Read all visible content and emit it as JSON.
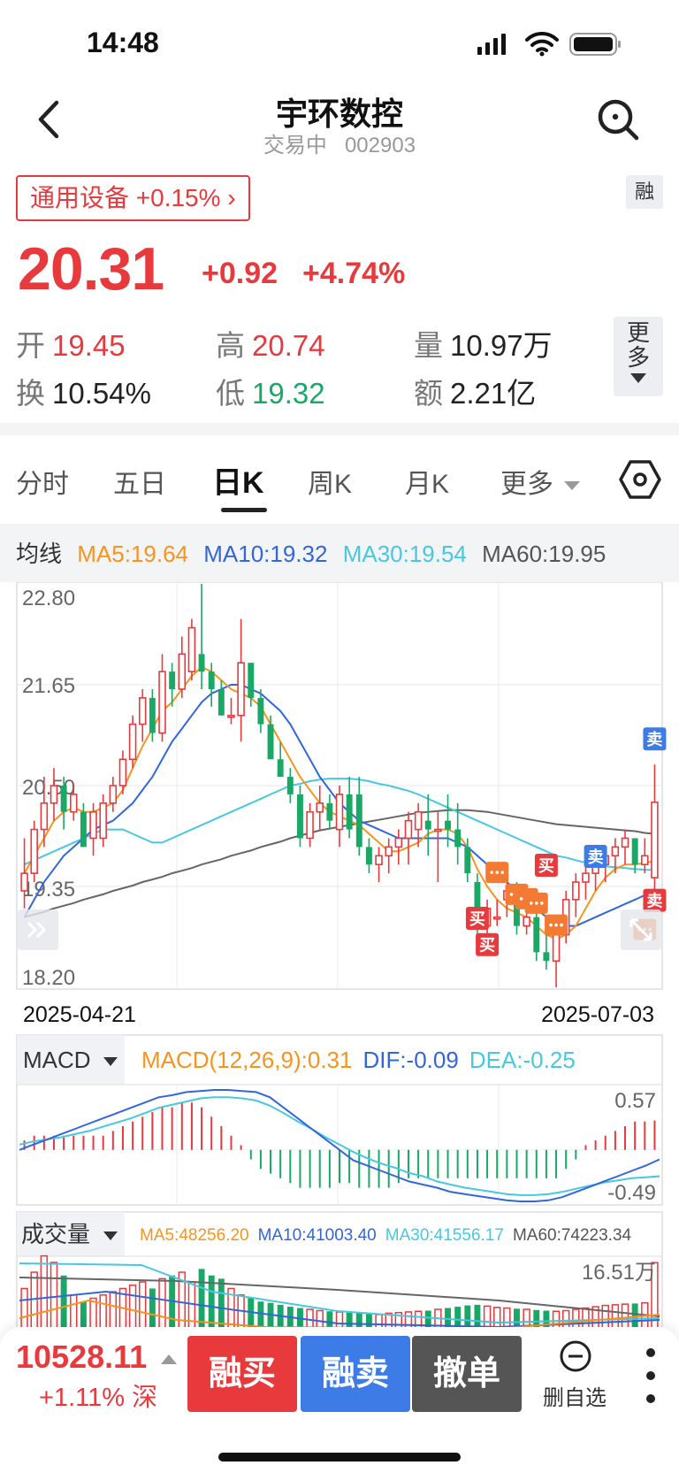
{
  "status_bar": {
    "time": "14:48"
  },
  "header": {
    "title": "宇环数控",
    "status": "交易中",
    "code": "002903"
  },
  "sector_tag": "通用设备 +0.15% ›",
  "margin_tag": "融",
  "quote": {
    "price": "20.31",
    "change": "+0.92",
    "change_pct": "+4.74%"
  },
  "stats": {
    "open": {
      "label": "开",
      "value": "19.45"
    },
    "high": {
      "label": "高",
      "value": "20.74"
    },
    "volume": {
      "label": "量",
      "value": "10.97万"
    },
    "turnover": {
      "label": "换",
      "value": "10.54%"
    },
    "low": {
      "label": "低",
      "value": "19.32"
    },
    "amount": {
      "label": "额",
      "value": "2.21亿"
    }
  },
  "more_btn": "更多",
  "tabs": [
    "分时",
    "五日",
    "日K",
    "周K",
    "月K",
    "更多"
  ],
  "active_tab": "日K",
  "ma_legend": {
    "label": "均线",
    "ma5": "MA5:19.64",
    "ma10": "MA10:19.32",
    "ma30": "MA30:19.54",
    "ma60": "MA60:19.95"
  },
  "colors": {
    "up": "#e8393d",
    "down": "#1aa866",
    "ma5": "#f7941d",
    "ma10": "#3366dd",
    "ma30": "#48c8e0",
    "ma60": "#666666",
    "sell_badge": "#3d7be6",
    "buy_badge": "#e8393d"
  },
  "price_chart": {
    "y_ticks": [
      "22.80",
      "21.65",
      "20.50",
      "19.35",
      "18.20"
    ],
    "date_start": "2025-04-21",
    "date_end": "2025-07-03",
    "markers": {
      "buy": "买",
      "sell": "卖"
    }
  },
  "macd_panel": {
    "selector": "MACD",
    "title": "MACD(12,26,9):0.31",
    "dif": "DIF:-0.09",
    "dea": "DEA:-0.25",
    "max_label": "0.57",
    "min_label": "-0.49"
  },
  "volume_panel": {
    "selector": "成交量",
    "ma5": "MA5:48256.20",
    "ma10": "MA10:41003.40",
    "ma30": "MA30:41556.17",
    "ma60": "MA60:74223.34",
    "max_label": "16.51万"
  },
  "bottom_bar": {
    "index_value": "10528.11",
    "index_change": "+1.11% 深",
    "margin_buy": "融买",
    "margin_sell": "融卖",
    "cancel": "撤单",
    "delete_watch": "删自选"
  },
  "chart_data": {
    "type": "candlestick",
    "title": "",
    "x_start": "2025-04-21",
    "x_end": "2025-07-03",
    "ylim": [
      18.2,
      22.8
    ],
    "candles": [
      [
        19.3,
        19.9,
        19.1,
        19.5
      ],
      [
        19.5,
        20.1,
        19.4,
        20.0
      ],
      [
        20.0,
        20.6,
        19.8,
        20.3
      ],
      [
        20.3,
        20.7,
        20.1,
        20.5
      ],
      [
        20.5,
        20.6,
        20.0,
        20.2
      ],
      [
        20.2,
        20.5,
        20.1,
        20.4
      ],
      [
        20.2,
        20.3,
        19.8,
        19.8
      ],
      [
        19.9,
        20.3,
        19.7,
        20.2
      ],
      [
        19.9,
        20.4,
        19.8,
        20.3
      ],
      [
        20.3,
        20.6,
        20.2,
        20.5
      ],
      [
        20.5,
        20.9,
        20.4,
        20.8
      ],
      [
        20.8,
        21.3,
        20.7,
        21.2
      ],
      [
        21.2,
        21.6,
        21.0,
        21.5
      ],
      [
        21.5,
        21.6,
        21.0,
        21.1
      ],
      [
        21.1,
        22.0,
        21.0,
        21.8
      ],
      [
        21.8,
        21.9,
        21.4,
        21.6
      ],
      [
        21.6,
        22.2,
        21.5,
        22.0
      ],
      [
        21.8,
        22.4,
        21.7,
        22.3
      ],
      [
        22.0,
        22.8,
        21.6,
        21.8
      ],
      [
        21.8,
        21.9,
        21.4,
        21.6
      ],
      [
        21.6,
        21.7,
        21.3,
        21.3
      ],
      [
        21.3,
        21.5,
        21.2,
        21.3
      ],
      [
        21.3,
        22.4,
        21.0,
        21.9
      ],
      [
        21.9,
        21.9,
        21.4,
        21.5
      ],
      [
        21.5,
        21.6,
        21.1,
        21.2
      ],
      [
        21.2,
        21.3,
        20.8,
        20.8
      ],
      [
        20.8,
        21.0,
        20.6,
        20.6
      ],
      [
        20.6,
        20.7,
        20.3,
        20.4
      ],
      [
        20.4,
        20.5,
        19.8,
        19.9
      ],
      [
        19.9,
        20.3,
        19.8,
        20.2
      ],
      [
        20.2,
        20.5,
        20.0,
        20.3
      ],
      [
        20.3,
        20.4,
        20.0,
        20.1
      ],
      [
        20.0,
        20.5,
        19.8,
        20.4
      ],
      [
        20.4,
        20.6,
        19.9,
        20.0
      ],
      [
        20.4,
        20.6,
        19.7,
        19.8
      ],
      [
        19.8,
        19.9,
        19.5,
        19.6
      ],
      [
        19.6,
        19.8,
        19.4,
        19.7
      ],
      [
        19.7,
        19.9,
        19.5,
        19.8
      ],
      [
        19.8,
        20.0,
        19.6,
        19.9
      ],
      [
        19.9,
        20.2,
        19.6,
        20.1
      ],
      [
        20.0,
        20.3,
        19.8,
        20.2
      ],
      [
        20.1,
        20.4,
        19.7,
        20.0
      ],
      [
        20.0,
        20.2,
        19.4,
        20.0
      ],
      [
        20.1,
        20.4,
        19.8,
        20.0
      ],
      [
        20.0,
        20.3,
        19.6,
        19.8
      ],
      [
        19.8,
        19.9,
        19.4,
        19.5
      ],
      [
        19.4,
        19.5,
        18.8,
        18.9
      ],
      [
        18.9,
        19.2,
        18.8,
        19.1
      ],
      [
        19.0,
        19.2,
        18.9,
        19.0
      ],
      [
        19.2,
        19.4,
        19.0,
        19.3
      ],
      [
        19.3,
        19.4,
        18.8,
        18.9
      ],
      [
        18.9,
        19.1,
        18.8,
        19.0
      ],
      [
        19.0,
        19.2,
        18.5,
        18.6
      ],
      [
        18.6,
        18.8,
        18.4,
        18.5
      ],
      [
        18.5,
        18.8,
        18.2,
        18.8
      ],
      [
        18.8,
        19.3,
        18.7,
        19.2
      ],
      [
        19.2,
        19.5,
        19.0,
        19.4
      ],
      [
        19.4,
        19.7,
        19.2,
        19.5
      ],
      [
        19.5,
        19.7,
        19.3,
        19.6
      ],
      [
        19.6,
        19.8,
        19.4,
        19.7
      ],
      [
        19.7,
        19.9,
        19.5,
        19.8
      ],
      [
        19.8,
        20.0,
        19.6,
        19.9
      ],
      [
        19.9,
        19.9,
        19.5,
        19.6
      ],
      [
        19.6,
        19.9,
        19.5,
        19.7
      ],
      [
        19.45,
        20.74,
        19.32,
        20.31
      ]
    ],
    "ma5": [
      19.5,
      19.7,
      19.9,
      20.1,
      20.2,
      20.25,
      20.2,
      20.2,
      20.25,
      20.3,
      20.45,
      20.7,
      20.95,
      21.15,
      21.35,
      21.45,
      21.6,
      21.75,
      21.85,
      21.8,
      21.7,
      21.6,
      21.55,
      21.5,
      21.4,
      21.2,
      21.0,
      20.8,
      20.6,
      20.45,
      20.3,
      20.2,
      20.15,
      20.1,
      20.05,
      19.95,
      19.85,
      19.75,
      19.75,
      19.8,
      19.85,
      19.95,
      20.0,
      20.0,
      19.95,
      19.8,
      19.55,
      19.35,
      19.2,
      19.1,
      19.05,
      19.0,
      18.9,
      18.8,
      18.75,
      18.8,
      18.9,
      19.1,
      19.3,
      19.45,
      19.55,
      19.6,
      19.6,
      19.62,
      19.64
    ],
    "ma10": [
      19.0,
      19.2,
      19.4,
      19.55,
      19.7,
      19.8,
      19.9,
      20.0,
      20.05,
      20.1,
      20.2,
      20.3,
      20.45,
      20.6,
      20.8,
      21.0,
      21.15,
      21.3,
      21.45,
      21.55,
      21.6,
      21.65,
      21.65,
      21.6,
      21.55,
      21.45,
      21.35,
      21.2,
      21.0,
      20.8,
      20.6,
      20.45,
      20.3,
      20.2,
      20.1,
      20.05,
      20.0,
      19.95,
      19.9,
      19.9,
      19.9,
      19.9,
      19.9,
      19.9,
      19.85,
      19.8,
      19.7,
      19.6,
      19.5,
      19.4,
      19.3,
      19.2,
      19.1,
      19.0,
      18.95,
      18.9,
      18.9,
      18.95,
      19.0,
      19.05,
      19.1,
      19.15,
      19.2,
      19.25,
      19.32
    ],
    "ma30": [
      19.6,
      19.65,
      19.7,
      19.75,
      19.8,
      19.85,
      19.9,
      19.95,
      20.0,
      20.0,
      20.0,
      19.95,
      19.9,
      19.85,
      19.85,
      19.9,
      19.95,
      20.0,
      20.05,
      20.1,
      20.15,
      20.2,
      20.25,
      20.3,
      20.35,
      20.4,
      20.45,
      20.5,
      20.52,
      20.55,
      20.57,
      20.58,
      20.58,
      20.58,
      20.57,
      20.55,
      20.52,
      20.5,
      20.47,
      20.44,
      20.4,
      20.35,
      20.3,
      20.25,
      20.2,
      20.15,
      20.1,
      20.05,
      20.0,
      19.95,
      19.9,
      19.85,
      19.8,
      19.75,
      19.7,
      19.68,
      19.65,
      19.62,
      19.6,
      19.58,
      19.57,
      19.56,
      19.55,
      19.54,
      19.54
    ],
    "ma60": [
      19.0,
      19.03,
      19.06,
      19.1,
      19.13,
      19.16,
      19.2,
      19.23,
      19.26,
      19.3,
      19.33,
      19.36,
      19.4,
      19.43,
      19.46,
      19.5,
      19.53,
      19.56,
      19.6,
      19.63,
      19.66,
      19.7,
      19.73,
      19.76,
      19.8,
      19.83,
      19.86,
      19.9,
      19.93,
      19.96,
      19.99,
      20.01,
      20.03,
      20.05,
      20.07,
      20.09,
      20.11,
      20.13,
      20.15,
      20.17,
      20.19,
      20.2,
      20.21,
      20.22,
      20.22,
      20.22,
      20.21,
      20.2,
      20.18,
      20.16,
      20.14,
      20.12,
      20.1,
      20.08,
      20.06,
      20.05,
      20.04,
      20.03,
      20.02,
      20.01,
      20.0,
      19.99,
      19.98,
      19.96,
      19.95
    ],
    "macd_hist": [
      0.1,
      0.15,
      0.15,
      0.15,
      0.15,
      0.15,
      0.15,
      0.15,
      0.15,
      0.2,
      0.25,
      0.3,
      0.35,
      0.4,
      0.45,
      0.45,
      0.5,
      0.5,
      0.45,
      0.35,
      0.25,
      0.15,
      0.05,
      -0.1,
      -0.2,
      -0.25,
      -0.3,
      -0.35,
      -0.4,
      -0.4,
      -0.4,
      -0.4,
      -0.35,
      -0.35,
      -0.4,
      -0.4,
      -0.4,
      -0.4,
      -0.35,
      -0.3,
      -0.3,
      -0.3,
      -0.3,
      -0.3,
      -0.3,
      -0.3,
      -0.3,
      -0.3,
      -0.3,
      -0.3,
      -0.3,
      -0.3,
      -0.3,
      -0.3,
      -0.3,
      -0.2,
      -0.1,
      0.05,
      0.1,
      0.15,
      0.2,
      0.25,
      0.3,
      0.3,
      0.31
    ],
    "dif": [
      0.0,
      0.05,
      0.1,
      0.15,
      0.2,
      0.25,
      0.3,
      0.35,
      0.4,
      0.45,
      0.5,
      0.52,
      0.55,
      0.56,
      0.57,
      0.57,
      0.56,
      0.55,
      0.5,
      0.4,
      0.3,
      0.2,
      0.1,
      0.0,
      -0.1,
      -0.15,
      -0.2,
      -0.25,
      -0.3,
      -0.33,
      -0.36,
      -0.4,
      -0.42,
      -0.44,
      -0.46,
      -0.48,
      -0.49,
      -0.49,
      -0.48,
      -0.45,
      -0.4,
      -0.35,
      -0.3,
      -0.25,
      -0.2,
      -0.15,
      -0.09
    ],
    "dea": [
      0.05,
      0.08,
      0.1,
      0.12,
      0.15,
      0.18,
      0.22,
      0.26,
      0.3,
      0.35,
      0.4,
      0.43,
      0.46,
      0.49,
      0.5,
      0.5,
      0.49,
      0.47,
      0.42,
      0.35,
      0.27,
      0.2,
      0.12,
      0.05,
      -0.02,
      -0.08,
      -0.13,
      -0.17,
      -0.22,
      -0.25,
      -0.3,
      -0.33,
      -0.36,
      -0.38,
      -0.4,
      -0.42,
      -0.43,
      -0.43,
      -0.42,
      -0.4,
      -0.37,
      -0.34,
      -0.31,
      -0.29,
      -0.27,
      -0.26,
      -0.25
    ],
    "volume": [
      70000,
      95000,
      120000,
      110000,
      90000,
      60000,
      50000,
      55000,
      60000,
      65000,
      70000,
      75000,
      80000,
      70000,
      85000,
      90000,
      95000,
      80000,
      100000,
      90000,
      85000,
      70000,
      60000,
      55000,
      50000,
      48000,
      45000,
      42000,
      40000,
      38000,
      36000,
      35000,
      34000,
      33000,
      32000,
      31000,
      30000,
      32000,
      33000,
      34000,
      35000,
      36000,
      38000,
      40000,
      42000,
      44000,
      45000,
      43000,
      41000,
      40000,
      39000,
      38000,
      37000,
      36000,
      35000,
      36000,
      38000,
      40000,
      42000,
      44000,
      45000,
      46000,
      47000,
      48000,
      109700
    ]
  }
}
